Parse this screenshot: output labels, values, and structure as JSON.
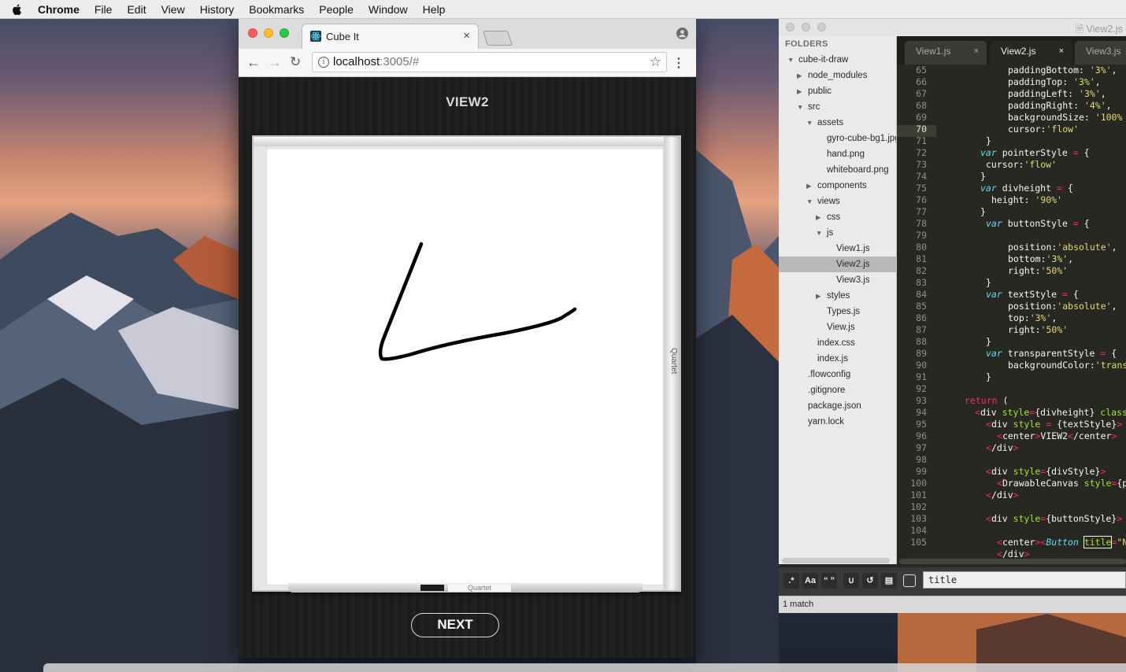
{
  "menubar": {
    "app": "Chrome",
    "items": [
      "File",
      "Edit",
      "View",
      "History",
      "Bookmarks",
      "People",
      "Window",
      "Help"
    ]
  },
  "browser": {
    "tab_title": "Cube It",
    "tab_close": "×",
    "url_host": "localhost",
    "url_rest": ":3005/#",
    "star": "☆",
    "menu": "⋮"
  },
  "app": {
    "title": "VIEW2",
    "board_side_label": "Quartet",
    "board_tray_label": "Quartet",
    "next_button": "NEXT"
  },
  "editor": {
    "window_title": "View2.js",
    "sidebar_header": "FOLDERS",
    "tree": [
      {
        "label": "cube-it-draw",
        "depth": 0,
        "twisty": "▼"
      },
      {
        "label": "node_modules",
        "depth": 1,
        "twisty": "▶"
      },
      {
        "label": "public",
        "depth": 1,
        "twisty": "▶"
      },
      {
        "label": "src",
        "depth": 1,
        "twisty": "▼"
      },
      {
        "label": "assets",
        "depth": 2,
        "twisty": "▼"
      },
      {
        "label": "gyro-cube-bg1.jpg",
        "depth": 3,
        "twisty": ""
      },
      {
        "label": "hand.png",
        "depth": 3,
        "twisty": ""
      },
      {
        "label": "whiteboard.png",
        "depth": 3,
        "twisty": ""
      },
      {
        "label": "components",
        "depth": 2,
        "twisty": "▶"
      },
      {
        "label": "views",
        "depth": 2,
        "twisty": "▼"
      },
      {
        "label": "css",
        "depth": 3,
        "twisty": "▶"
      },
      {
        "label": "js",
        "depth": 3,
        "twisty": "▼"
      },
      {
        "label": "View1.js",
        "depth": 4,
        "twisty": ""
      },
      {
        "label": "View2.js",
        "depth": 4,
        "twisty": "",
        "selected": true
      },
      {
        "label": "View3.js",
        "depth": 4,
        "twisty": ""
      },
      {
        "label": "styles",
        "depth": 3,
        "twisty": "▶"
      },
      {
        "label": "Types.js",
        "depth": 3,
        "twisty": ""
      },
      {
        "label": "View.js",
        "depth": 3,
        "twisty": ""
      },
      {
        "label": "index.css",
        "depth": 2,
        "twisty": ""
      },
      {
        "label": "index.js",
        "depth": 2,
        "twisty": ""
      },
      {
        "label": ".flowconfig",
        "depth": 1,
        "twisty": ""
      },
      {
        "label": ".gitignore",
        "depth": 1,
        "twisty": ""
      },
      {
        "label": "package.json",
        "depth": 1,
        "twisty": ""
      },
      {
        "label": "yarn.lock",
        "depth": 1,
        "twisty": ""
      }
    ],
    "tabs": [
      {
        "label": "View1.js",
        "close": "×",
        "active": false
      },
      {
        "label": "View2.js",
        "close": "×",
        "active": true
      },
      {
        "label": "View3.js",
        "close": "",
        "active": false
      }
    ],
    "line_numbers": [
      "65",
      "66",
      "67",
      "68",
      "69",
      "70",
      "71",
      "72",
      "73",
      "74",
      "75",
      "76",
      "77",
      "78",
      "79",
      "80",
      "81",
      "82",
      "83",
      "84",
      "85",
      "86",
      "87",
      "88",
      "89",
      "90",
      "91",
      "92",
      "93",
      "94",
      "95",
      "96",
      "97",
      "98",
      "99",
      "100",
      "101",
      "102",
      "103",
      "104",
      "105"
    ],
    "current_line": "70",
    "find_buttons": [
      ".*",
      "Aa",
      "“ ”"
    ],
    "find_value": "title",
    "status": "1 match"
  },
  "colors": {
    "code_bg": "#272822",
    "keyword": "#66d9ef",
    "operator": "#f92672",
    "string": "#e6db74",
    "chrome_close": "#fc5f57",
    "chrome_min": "#fdbc2e",
    "chrome_max": "#28c840"
  }
}
